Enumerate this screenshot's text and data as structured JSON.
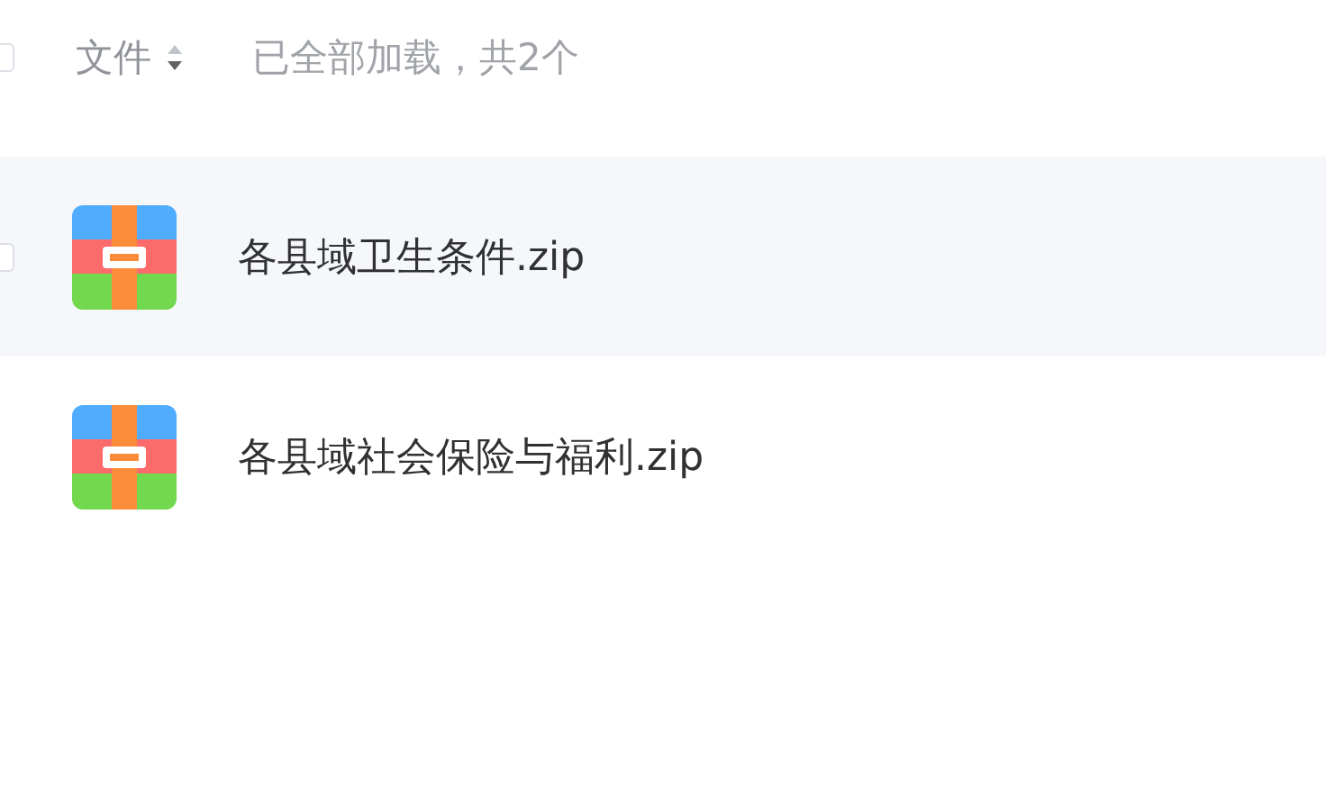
{
  "header": {
    "checked": false,
    "column_label": "文件",
    "sort_descending": true,
    "status": "已全部加载，共2个"
  },
  "files": [
    {
      "name": "各县域卫生条件.zip",
      "hovered": true,
      "checked": false
    },
    {
      "name": "各县域社会保险与福利.zip",
      "hovered": false,
      "checked": false
    }
  ]
}
